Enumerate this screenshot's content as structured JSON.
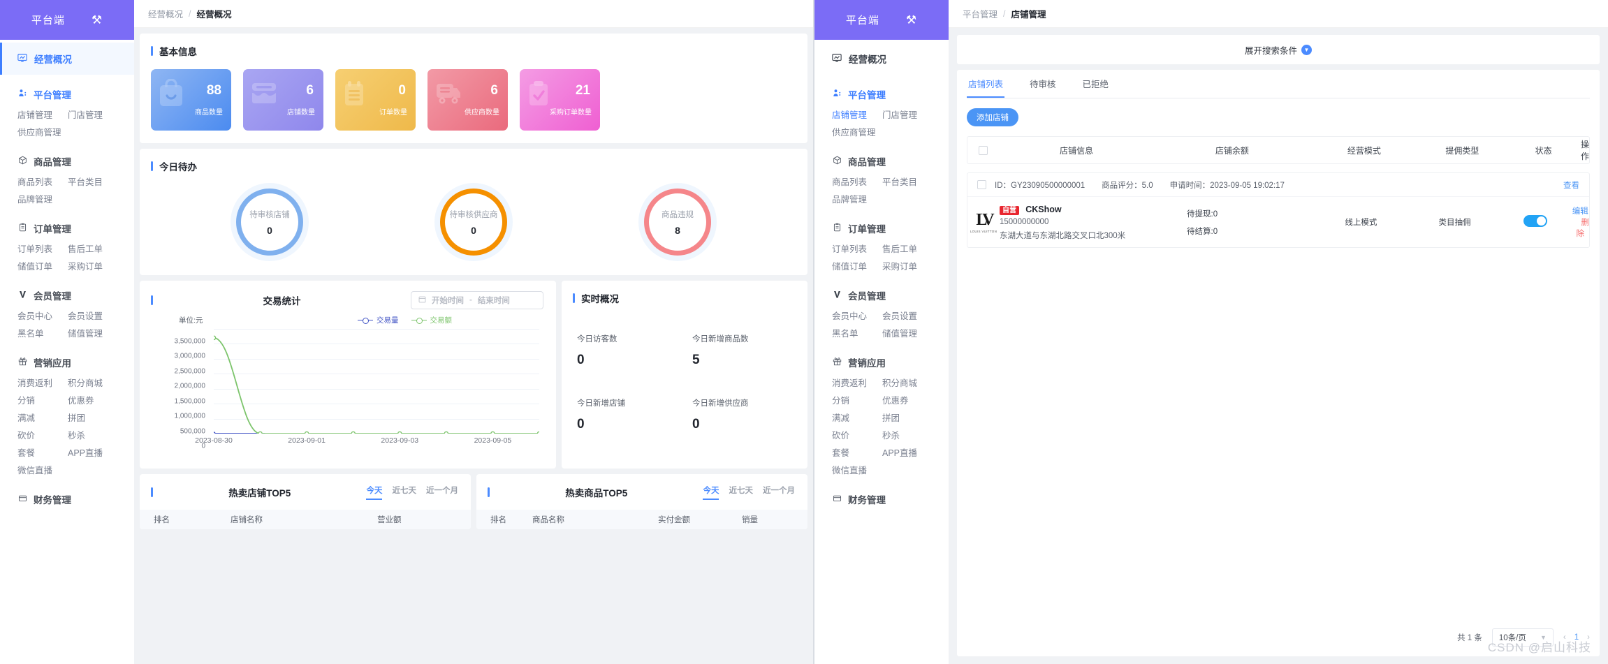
{
  "brand": {
    "name": "平台端",
    "tool_icon": "⚒"
  },
  "sidebar": {
    "overview": {
      "label": "经营概况",
      "icon": "chart-monitor-icon"
    },
    "groups": [
      {
        "title": "平台管理",
        "icon": "user-cog-icon",
        "links": [
          "店铺管理",
          "门店管理",
          "供应商管理"
        ]
      },
      {
        "title": "商品管理",
        "icon": "box-icon",
        "links": [
          "商品列表",
          "平台类目",
          "品牌管理"
        ]
      },
      {
        "title": "订单管理",
        "icon": "clipboard-icon",
        "links": [
          "订单列表",
          "售后工单",
          "储值订单",
          "采购订单"
        ]
      },
      {
        "title": "会员管理",
        "icon": "vip-icon",
        "links": [
          "会员中心",
          "会员设置",
          "黑名单",
          "储值管理"
        ]
      },
      {
        "title": "营销应用",
        "icon": "gift-icon",
        "links": [
          "消费返利",
          "积分商城",
          "分销",
          "优惠券",
          "满减",
          "拼团",
          "砍价",
          "秒杀",
          "套餐",
          "APP直播",
          "微信直播"
        ]
      },
      {
        "title": "财务管理",
        "icon": "wallet-icon",
        "links": []
      }
    ]
  },
  "left_window": {
    "breadcrumb": {
      "parent": "经营概况",
      "current": "经营概况"
    },
    "basic_info": {
      "title": "基本信息",
      "tiles": [
        {
          "value": "88",
          "label": "商品数量",
          "glyph": "🛍",
          "color": "#4b8bf0"
        },
        {
          "value": "6",
          "label": "店铺数量",
          "glyph": "🏪",
          "color": "#8f87ec"
        },
        {
          "value": "0",
          "label": "订单数量",
          "glyph": "📋",
          "color": "#efb94a"
        },
        {
          "value": "6",
          "label": "供应商数量",
          "glyph": "🚚",
          "color": "#ea6a7d"
        },
        {
          "value": "21",
          "label": "采购订单数量",
          "glyph": "📋",
          "color": "#ef5fd2"
        }
      ]
    },
    "todo": {
      "title": "今日待办",
      "items": [
        {
          "label": "待审核店铺",
          "value": "0",
          "color": "#7fb0ee"
        },
        {
          "label": "待审核供应商",
          "value": "0",
          "color": "#f59000"
        },
        {
          "label": "商品违规",
          "value": "8",
          "color": "#f5868a"
        }
      ]
    },
    "trade": {
      "title": "交易统计",
      "date_start_placeholder": "开始时间",
      "date_end_placeholder": "结束时间",
      "date_separator": "-"
    },
    "realtime": {
      "title": "实时概况",
      "items": [
        {
          "label": "今日访客数",
          "value": "0"
        },
        {
          "label": "今日新增商品数",
          "value": "5"
        },
        {
          "label": "今日新增店铺",
          "value": "0"
        },
        {
          "label": "今日新增供应商",
          "value": "0"
        }
      ]
    },
    "top_shops": {
      "title": "热卖店铺TOP5",
      "segments": [
        "今天",
        "近七天",
        "近一个月"
      ],
      "active_segment": "今天",
      "columns": [
        "排名",
        "店铺名称",
        "营业额"
      ]
    },
    "top_goods": {
      "title": "热卖商品TOP5",
      "segments": [
        "今天",
        "近七天",
        "近一个月"
      ],
      "active_segment": "今天",
      "columns": [
        "排名",
        "商品名称",
        "实付金额",
        "销量"
      ]
    }
  },
  "chart_data": {
    "type": "line",
    "title": "交易统计",
    "unit_label": "单位:元",
    "xlabel": "",
    "ylabel": "单位:元",
    "x": [
      "2023-08-30",
      "2023-08-31",
      "2023-09-01",
      "2023-09-02",
      "2023-09-03",
      "2023-09-04",
      "2023-09-05",
      "2023-09-06"
    ],
    "tick_labels": [
      "2023-08-30",
      "2023-09-01",
      "2023-09-03",
      "2023-09-05"
    ],
    "ytick_labels": [
      "0",
      "500,000",
      "1,000,000",
      "1,500,000",
      "2,000,000",
      "2,500,000",
      "3,000,000",
      "3,500,000"
    ],
    "ylim": [
      0,
      3500000
    ],
    "grid": true,
    "legend_position": "top-right",
    "series": [
      {
        "name": "交易量",
        "color": "#4254c5",
        "values": [
          0,
          0,
          0,
          0,
          0,
          0,
          0,
          0
        ]
      },
      {
        "name": "交易额",
        "color": "#7cc46b",
        "values": [
          3200000,
          0,
          0,
          0,
          0,
          0,
          0,
          0
        ]
      }
    ]
  },
  "right_window": {
    "breadcrumb": {
      "parent": "平台管理",
      "current": "店铺管理"
    },
    "search_toggle": "展开搜索条件",
    "tabs": [
      {
        "label": "店铺列表",
        "active": true
      },
      {
        "label": "待审核",
        "active": false
      },
      {
        "label": "已拒绝",
        "active": false
      }
    ],
    "add_button": "添加店铺",
    "table": {
      "columns": [
        "店铺信息",
        "店铺余额",
        "经营模式",
        "提佣类型",
        "状态",
        "操作"
      ],
      "rows": [
        {
          "meta": {
            "id_label": "ID：GY23090500000001",
            "rating_label": "商品评分：5.0",
            "apply_label": "申请时间：2023-09-05 19:02:17",
            "view_action": "查看"
          },
          "logo_mark": "LV",
          "logo_sub": "LOUIS VUITTON",
          "badge": "自营",
          "name": "CKShow",
          "phone": "15000000000",
          "address": "东湖大道与东湖北路交叉口北300米",
          "balance_pending_withdraw": "待提现:0",
          "balance_pending_settle": "待结算:0",
          "mode": "线上模式",
          "commission_type": "类目抽佣",
          "status_on": true,
          "actions": [
            "编辑",
            "删除"
          ]
        }
      ]
    },
    "pagination": {
      "total": "共 1 条",
      "page_size": "10条/页",
      "prev": "‹",
      "page": "1",
      "next": "›"
    },
    "watermark": "CSDN @启山科技"
  }
}
